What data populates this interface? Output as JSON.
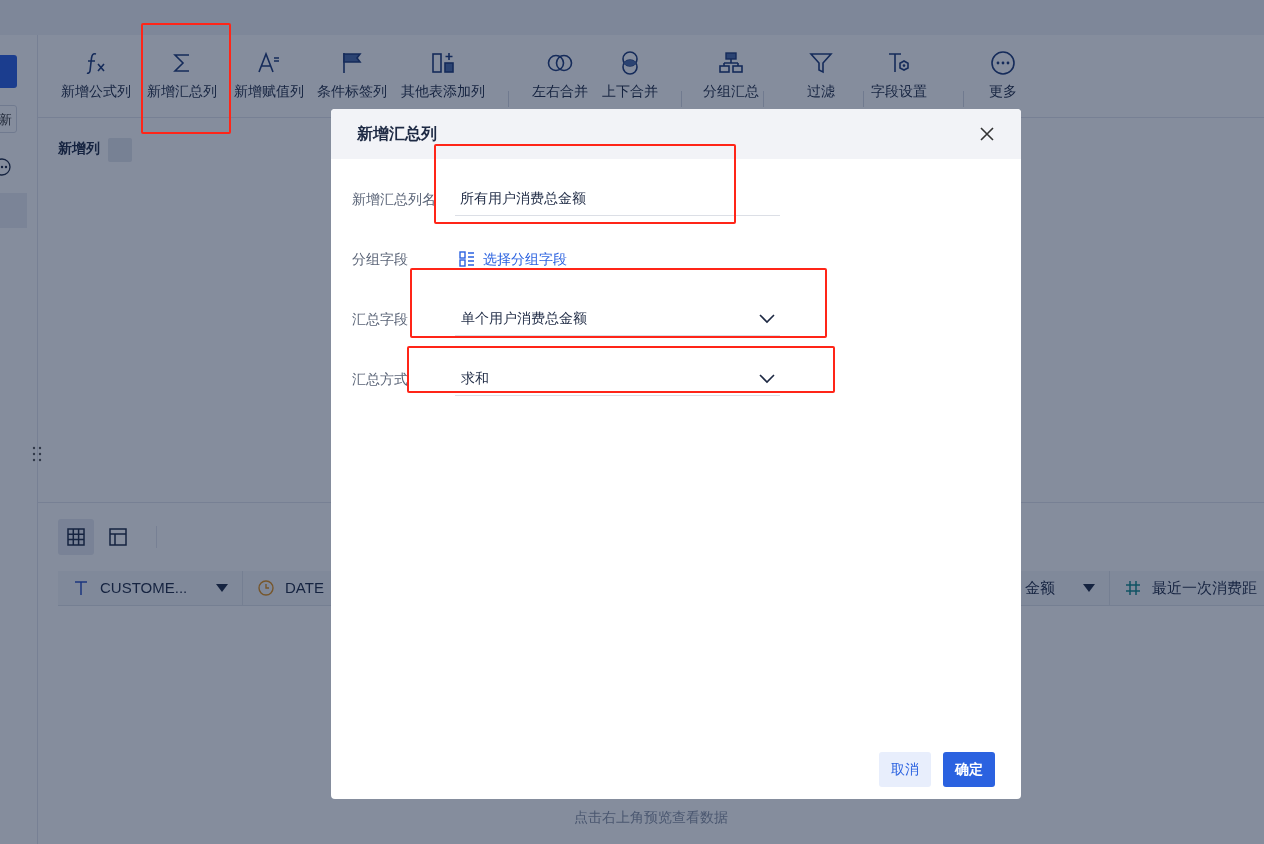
{
  "sidebar": {
    "button_label": "新"
  },
  "toolbar": [
    {
      "label": "新增公式列",
      "separator_before": false
    },
    {
      "label": "新增汇总列",
      "separator_before": false
    },
    {
      "label": "新增赋值列",
      "separator_before": false
    },
    {
      "label": "条件标签列",
      "separator_before": false
    },
    {
      "label": "其他表添加列",
      "separator_before": false
    },
    {
      "label": "左右合并",
      "separator_before": true
    },
    {
      "label": "上下合并",
      "separator_before": false
    },
    {
      "label": "分组汇总",
      "separator_before": true
    },
    {
      "label": "过滤",
      "separator_before": true
    },
    {
      "label": "字段设置",
      "separator_before": true
    },
    {
      "label": "更多",
      "separator_before": true
    }
  ],
  "section_title": "新增列",
  "view_toggles": [
    {
      "kind": "grid",
      "selected": true
    },
    {
      "kind": "layout",
      "selected": false
    }
  ],
  "columns": [
    {
      "label": "CUSTOME...",
      "kind": "text",
      "menu": true
    },
    {
      "label": "DATE",
      "kind": "date",
      "menu": false
    },
    {
      "label": "金额",
      "menu": true
    },
    {
      "label": "最近一次消费距",
      "kind": "number",
      "menu": false
    }
  ],
  "empty_hint": "点击右上角预览查看数据",
  "dialog": {
    "title": "新增汇总列",
    "fields": [
      {
        "kind": "text",
        "label": "新增汇总列名",
        "value": "所有用户消费总金额"
      },
      {
        "kind": "picker",
        "label": "分组字段",
        "link": "选择分组字段"
      },
      {
        "kind": "select",
        "label": "汇总字段",
        "value": "单个用户消费总金额"
      },
      {
        "kind": "select",
        "label": "汇总方式",
        "value": "求和"
      }
    ],
    "buttons": [
      {
        "label": "取消",
        "kind": "secondary"
      },
      {
        "label": "确定",
        "kind": "primary"
      }
    ]
  }
}
